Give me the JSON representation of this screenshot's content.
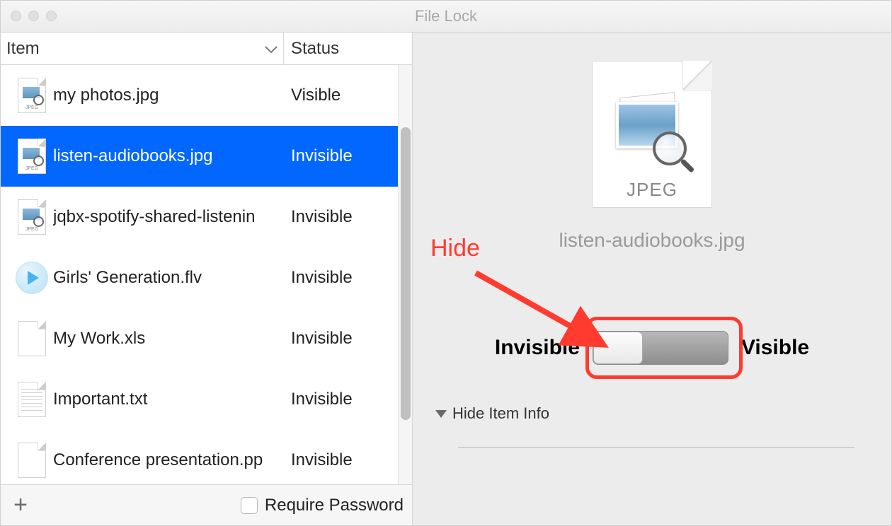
{
  "window": {
    "title": "File Lock"
  },
  "columns": {
    "item": "Item",
    "status": "Status"
  },
  "files": [
    {
      "icon": "jpeg",
      "name": "my photos.jpg",
      "status": "Visible",
      "selected": false
    },
    {
      "icon": "jpeg",
      "name": "listen-audiobooks.jpg",
      "status": "Invisible",
      "selected": true
    },
    {
      "icon": "jpeg",
      "name": "jqbx-spotify-shared-listenin",
      "status": "Invisible",
      "selected": false
    },
    {
      "icon": "flv",
      "name": "Girls' Generation.flv",
      "status": "Invisible",
      "selected": false
    },
    {
      "icon": "xls",
      "name": "My Work.xls",
      "status": "Invisible",
      "selected": false
    },
    {
      "icon": "txt",
      "name": "Important.txt",
      "status": "Invisible",
      "selected": false
    },
    {
      "icon": "pp",
      "name": "Conference presentation.pp",
      "status": "Invisible",
      "selected": false
    }
  ],
  "bottom": {
    "require_password": "Require Password"
  },
  "preview": {
    "filetype_label": "JPEG",
    "filename": "listen-audiobooks.jpg",
    "invisible": "Invisible",
    "visible": "Visible",
    "hide_info": "Hide Item Info"
  },
  "annotation": {
    "hide": "Hide"
  }
}
